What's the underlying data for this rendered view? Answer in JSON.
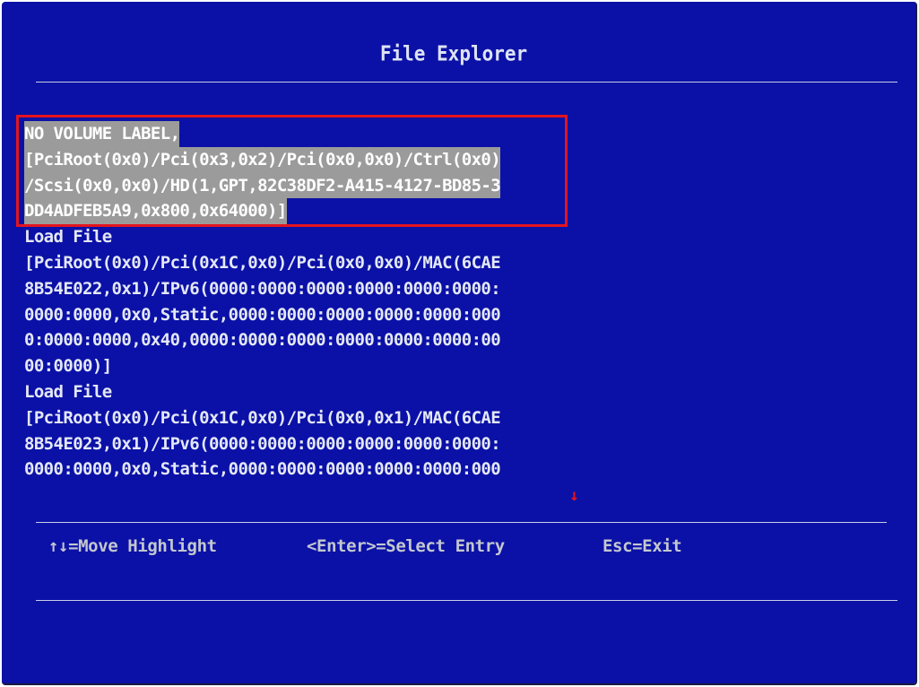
{
  "title": "File Explorer",
  "entries": [
    {
      "lines": [
        "NO VOLUME LABEL,",
        "[PciRoot(0x0)/Pci(0x3,0x2)/Pci(0x0,0x0)/Ctrl(0x0)",
        "/Scsi(0x0,0x0)/HD(1,GPT,82C38DF2-A415-4127-BD85-3",
        "DD4ADFEB5A9,0x800,0x64000)]"
      ]
    },
    {
      "lines": [
        "Load File",
        "[PciRoot(0x0)/Pci(0x1C,0x0)/Pci(0x0,0x0)/MAC(6CAE",
        "8B54E022,0x1)/IPv6(0000:0000:0000:0000:0000:0000:",
        "0000:0000,0x0,Static,0000:0000:0000:0000:0000:000",
        "0:0000:0000,0x40,0000:0000:0000:0000:0000:0000:00",
        "00:0000)]"
      ]
    },
    {
      "lines": [
        "Load File",
        "[PciRoot(0x0)/Pci(0x1C,0x0)/Pci(0x0,0x1)/MAC(6CAE",
        "8B54E023,0x1)/IPv6(0000:0000:0000:0000:0000:0000:",
        "0000:0000,0x0,Static,0000:0000:0000:0000:0000:000"
      ]
    }
  ],
  "scroll_indicator": "↓",
  "help": {
    "move": "↑↓=Move Highlight",
    "enter": "<Enter>=Select Entry",
    "esc": "Esc=Exit"
  },
  "colors": {
    "background": "#0b11a6",
    "text": "#e4e8f6",
    "highlight_bg": "#9b9b9b",
    "annotation_red": "#e4141e"
  }
}
